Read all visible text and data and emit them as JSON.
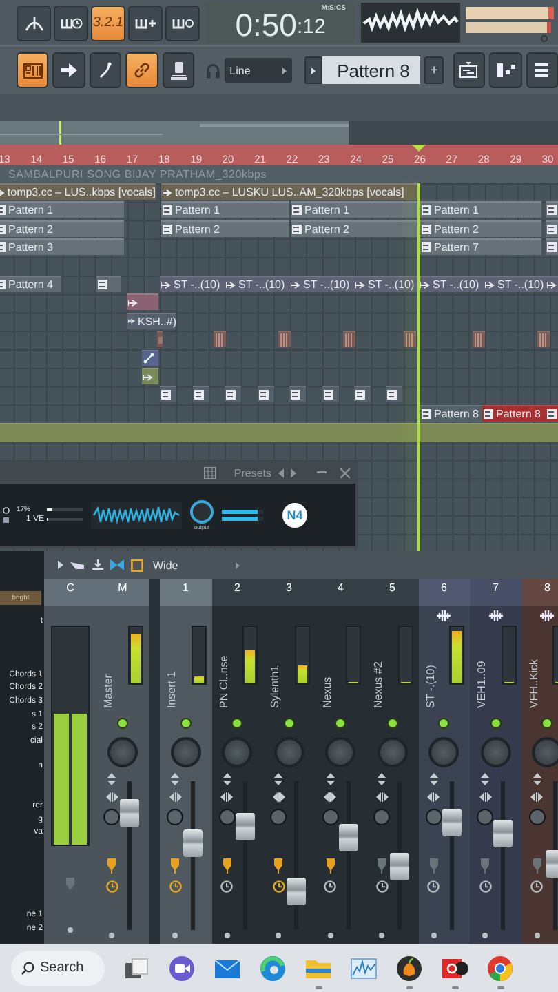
{
  "toolbar": {
    "buttons": [
      {
        "on": false
      },
      {
        "on": false
      },
      {
        "label": "3.2.1",
        "on": true
      },
      {
        "on": false
      },
      {
        "on": false
      }
    ],
    "time": {
      "main": "0:50",
      "sub": ":12",
      "unit": "M:S:CS"
    },
    "tools": [
      {
        "on": true
      },
      {
        "on": false
      },
      {
        "on": false
      },
      {
        "on": true
      },
      {
        "on": false
      }
    ],
    "snap": "Line",
    "pattern": "Pattern 8",
    "add": "+"
  },
  "playlist": {
    "ruler": [
      "13",
      "14",
      "15",
      "16",
      "17",
      "18",
      "19",
      "20",
      "21",
      "22",
      "23",
      "24",
      "25",
      "26",
      "27",
      "28",
      "29",
      "30"
    ],
    "title": "SAMBALPURI SONG  BIJAY  PRATHAM_320kbps",
    "rows": [
      {
        "clips": [
          {
            "kind": "audio",
            "label": "tomp3.cc – LUS..kbps [vocals]",
            "color": "#6b6452"
          },
          {
            "kind": "audio",
            "label": "tomp3.cc – LUSKU LUS..AM_320kbps [vocals]",
            "color": "#6b6452"
          }
        ]
      },
      {
        "clips": [
          {
            "kind": "pattern",
            "label": "Pattern 1",
            "color": "#67727a"
          },
          {
            "kind": "pattern",
            "label": "Pattern 1",
            "color": "#67727a"
          },
          {
            "kind": "pattern",
            "label": "Pattern 1",
            "color": "#67727a"
          },
          {
            "kind": "pattern",
            "label": "Pattern 1",
            "color": "#67727a"
          },
          {
            "kind": "pattern",
            "color": "#67727a"
          }
        ]
      },
      {
        "clips": [
          {
            "kind": "pattern",
            "label": "Pattern 2",
            "color": "#67727a"
          },
          {
            "kind": "pattern",
            "label": "Pattern 2",
            "color": "#67727a"
          },
          {
            "kind": "pattern",
            "label": "Pattern 2",
            "color": "#67727a"
          },
          {
            "kind": "pattern",
            "label": "Pattern 2",
            "color": "#67727a"
          },
          {
            "kind": "pattern",
            "color": "#67727a"
          }
        ]
      },
      {
        "clips": [
          {
            "kind": "pattern",
            "label": "Pattern 3",
            "color": "#67727a"
          },
          {
            "kind": "pattern",
            "label": "Pattern 7",
            "color": "#67727a"
          },
          {
            "kind": "pattern",
            "color": "#67727a"
          }
        ]
      },
      {
        "clips": []
      },
      {
        "clips": [
          {
            "kind": "pattern",
            "label": "Pattern 4",
            "color": "#5f6a72"
          },
          {
            "kind": "pattern",
            "color": "#5f6a72"
          },
          {
            "kind": "audio",
            "label": "ST -..(10)",
            "color": "#5f6274"
          },
          {
            "kind": "audio",
            "label": "ST -..(10)",
            "color": "#5f6274"
          },
          {
            "kind": "audio",
            "label": "ST -..(10)",
            "color": "#5f6274"
          },
          {
            "kind": "audio",
            "label": "ST -..(10)",
            "color": "#5f6274"
          },
          {
            "kind": "audio",
            "label": "ST -..(10)",
            "color": "#5f6274"
          },
          {
            "kind": "audio",
            "label": "ST -..(10)",
            "color": "#5f6274"
          },
          {
            "kind": "audio",
            "color": "#5f6274"
          }
        ]
      },
      {
        "clips": [
          {
            "kind": "audio",
            "color": "#8a6272"
          }
        ]
      },
      {
        "clips": [
          {
            "kind": "audio",
            "label": "KSH..#)",
            "color": "#56606e"
          }
        ]
      },
      {
        "clips": [
          {
            "kind": "slice",
            "color": "#7a5a55"
          },
          {
            "kind": "slice",
            "color": "#7a5a55"
          },
          {
            "kind": "slice",
            "color": "#7a5a55"
          },
          {
            "kind": "slice",
            "color": "#7a5a55"
          },
          {
            "kind": "slice",
            "color": "#7a5a55"
          },
          {
            "kind": "slice",
            "color": "#7a5a55"
          },
          {
            "kind": "slice",
            "color": "#7a5a55"
          }
        ]
      },
      {
        "clips": [
          {
            "kind": "automation",
            "color": "#5a6290"
          }
        ]
      },
      {
        "clips": [
          {
            "kind": "audio",
            "color": "#7a8a5a"
          }
        ]
      },
      {
        "clips": [
          {
            "kind": "pattern",
            "color": "#55616a"
          },
          {
            "kind": "pattern",
            "color": "#55616a"
          },
          {
            "kind": "pattern",
            "color": "#55616a"
          },
          {
            "kind": "pattern",
            "color": "#55616a"
          },
          {
            "kind": "pattern",
            "color": "#55616a"
          },
          {
            "kind": "pattern",
            "color": "#55616a"
          },
          {
            "kind": "pattern",
            "color": "#55616a"
          },
          {
            "kind": "pattern",
            "color": "#55616a"
          }
        ]
      },
      {
        "clips": [
          {
            "kind": "pattern",
            "label": "Pattern 8",
            "color": "#56626a"
          },
          {
            "kind": "pattern",
            "label": "Pattern 8",
            "color": "#a83030"
          },
          {
            "kind": "pattern",
            "color": "#a83030"
          }
        ]
      }
    ]
  },
  "plugin": {
    "presets": "Presets",
    "cpu": {
      "reading": "17%",
      "level": 0.15
    },
    "voices": {
      "reading": "1",
      "unit": "VE",
      "level": 0.03
    },
    "output": {
      "label": "output",
      "level": 0.85
    },
    "logo": "N4"
  },
  "mixer": {
    "mode": "Wide",
    "channels": [
      {
        "number": "C",
        "level": 0.6,
        "record": false
      },
      {
        "number": "M",
        "name": "Master",
        "level": 0.85,
        "fader": {
          "level": 0.85
        },
        "record": true,
        "clock": true,
        "wave": false,
        "color": "#4a545a"
      },
      {
        "number": "1",
        "name": "Insert 1",
        "level": 0.1,
        "fader": {
          "level": 0.6
        },
        "record": true,
        "clock": true,
        "wave": false,
        "color": "#4f595f"
      },
      {
        "number": "2",
        "name": "PN Cl..nse",
        "level": 0.55,
        "fader": {
          "level": 0.74
        },
        "record": true,
        "clock": false,
        "wave": false,
        "color": "#262e33"
      },
      {
        "number": "3",
        "name": "Sylenth1",
        "level": 0.3,
        "fader": {
          "level": 0.2
        },
        "record": true,
        "clock": true,
        "wave": false,
        "color": "#262e33"
      },
      {
        "number": "4",
        "name": "Nexus",
        "level": 0,
        "fader": {
          "level": 0.65
        },
        "record": true,
        "clock": false,
        "wave": false,
        "color": "#262e33"
      },
      {
        "number": "5",
        "name": "Nexus #2",
        "level": 0,
        "fader": {
          "level": 0.41
        },
        "record": false,
        "clock": false,
        "wave": false,
        "color": "#262e33"
      },
      {
        "number": "6",
        "name": "ST -.(10)",
        "level": 0.9,
        "fader": {
          "level": 0.77
        },
        "record": false,
        "clock": false,
        "wave": true,
        "color": "#3b4252"
      },
      {
        "number": "7",
        "name": "VEH1..09",
        "level": 0,
        "fader": {
          "level": 0.68
        },
        "record": false,
        "clock": false,
        "wave": true,
        "color": "#353b4c"
      },
      {
        "number": "8",
        "name": "VFH..Kick",
        "level": 0,
        "fader": {
          "level": 0.43
        },
        "record": false,
        "clock": false,
        "wave": true,
        "color": "#4a3530"
      }
    ]
  },
  "browser": {
    "tag": "bright",
    "items": [
      "t",
      "Chords 1",
      "Chords 2",
      "Chords 3",
      "s 1",
      "s 2",
      "cial",
      "n",
      "rer",
      "g",
      "va",
      "ne 1",
      "ne 2"
    ]
  },
  "taskbar": {
    "search": "Search",
    "apps": [
      {
        "running": false
      },
      {
        "running": false
      },
      {
        "running": false
      },
      {
        "running": false
      },
      {
        "running": true
      },
      {
        "running": false
      },
      {
        "running": true
      },
      {
        "running": true
      },
      {
        "running": true
      }
    ]
  }
}
